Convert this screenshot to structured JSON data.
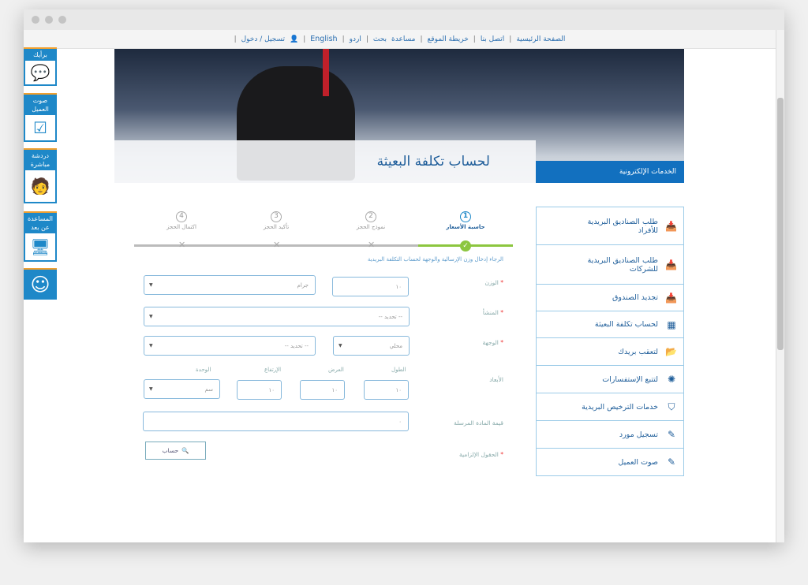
{
  "topnav": [
    "الصفحة الرئيسية",
    "اتصل بنا",
    "خريطة الموقع",
    "مساعدة",
    "بحث",
    "اردو",
    "English",
    "تسجيل / دخول"
  ],
  "side_widgets": [
    {
      "label": "برأيك",
      "icon": "speech-bubble-icon"
    },
    {
      "label": "صوت العميل",
      "icon": "checkbox-icon"
    },
    {
      "label": "دردشة مباشرة",
      "icon": "chat-agent-icon"
    },
    {
      "label": "المساعدة عن بعد",
      "icon": "remote-desktop-icon"
    },
    {
      "label": "",
      "icon": "smiley-icon"
    }
  ],
  "banner": {
    "title": "لحساب تكلفة البعيثة",
    "services_label": "الخدمات الإلكترونية"
  },
  "menu": [
    {
      "label": "طلب الصناديق البريدية للأفراد",
      "icon": "inbox-icon"
    },
    {
      "label": "طلب الصناديق البريدية للشركات",
      "icon": "inbox-icon"
    },
    {
      "label": "تجديد الصندوق",
      "icon": "inbox-icon"
    },
    {
      "label": "لحساب تكلفة البعيثة",
      "icon": "calculator-icon"
    },
    {
      "label": "لتعقب بريدك",
      "icon": "track-icon"
    },
    {
      "label": "لتتبع الإستفسارات",
      "icon": "spinner-icon"
    },
    {
      "label": "خدمات الترخيص البريدية",
      "icon": "shield-icon"
    },
    {
      "label": "تسجيل مورد",
      "icon": "edit-icon"
    },
    {
      "label": "صوت العميل",
      "icon": "edit-icon"
    }
  ],
  "steps": [
    {
      "num": "1",
      "label": "حاسبة الأسعار",
      "active": true
    },
    {
      "num": "2",
      "label": "نموذج الحجز"
    },
    {
      "num": "3",
      "label": "تأكيد الحجز"
    },
    {
      "num": "4",
      "label": "اكتمال الحجز"
    }
  ],
  "form": {
    "intro": "الرجاء إدخال وزن الإرسالية والوجهة لحساب التكلفة البريدية",
    "weight_label": "الوزن",
    "weight_value": "١٠",
    "weight_unit": "جرام",
    "origin_label": "المنشأ",
    "origin_value": "-- تحديد --",
    "dest_label": "الوجهة",
    "dest_type": "محلي",
    "dest_value": "-- تحديد --",
    "dims_label": "الأبعاد",
    "length_label": "الطول",
    "width_label": "العرض",
    "height_label": "الإرتفاع",
    "unit_label": "الوحدة",
    "length": "١٠",
    "width": "١٠",
    "height": "١٠",
    "dim_unit": "سم",
    "value_label": "قيمة المادة المرسلة",
    "value": "٠",
    "required_label": "الحقول الإلزامية",
    "calc_button": "حساب"
  },
  "colors": {
    "primary": "#1270bf",
    "accent": "#8cc63f",
    "required": "#e33333"
  }
}
